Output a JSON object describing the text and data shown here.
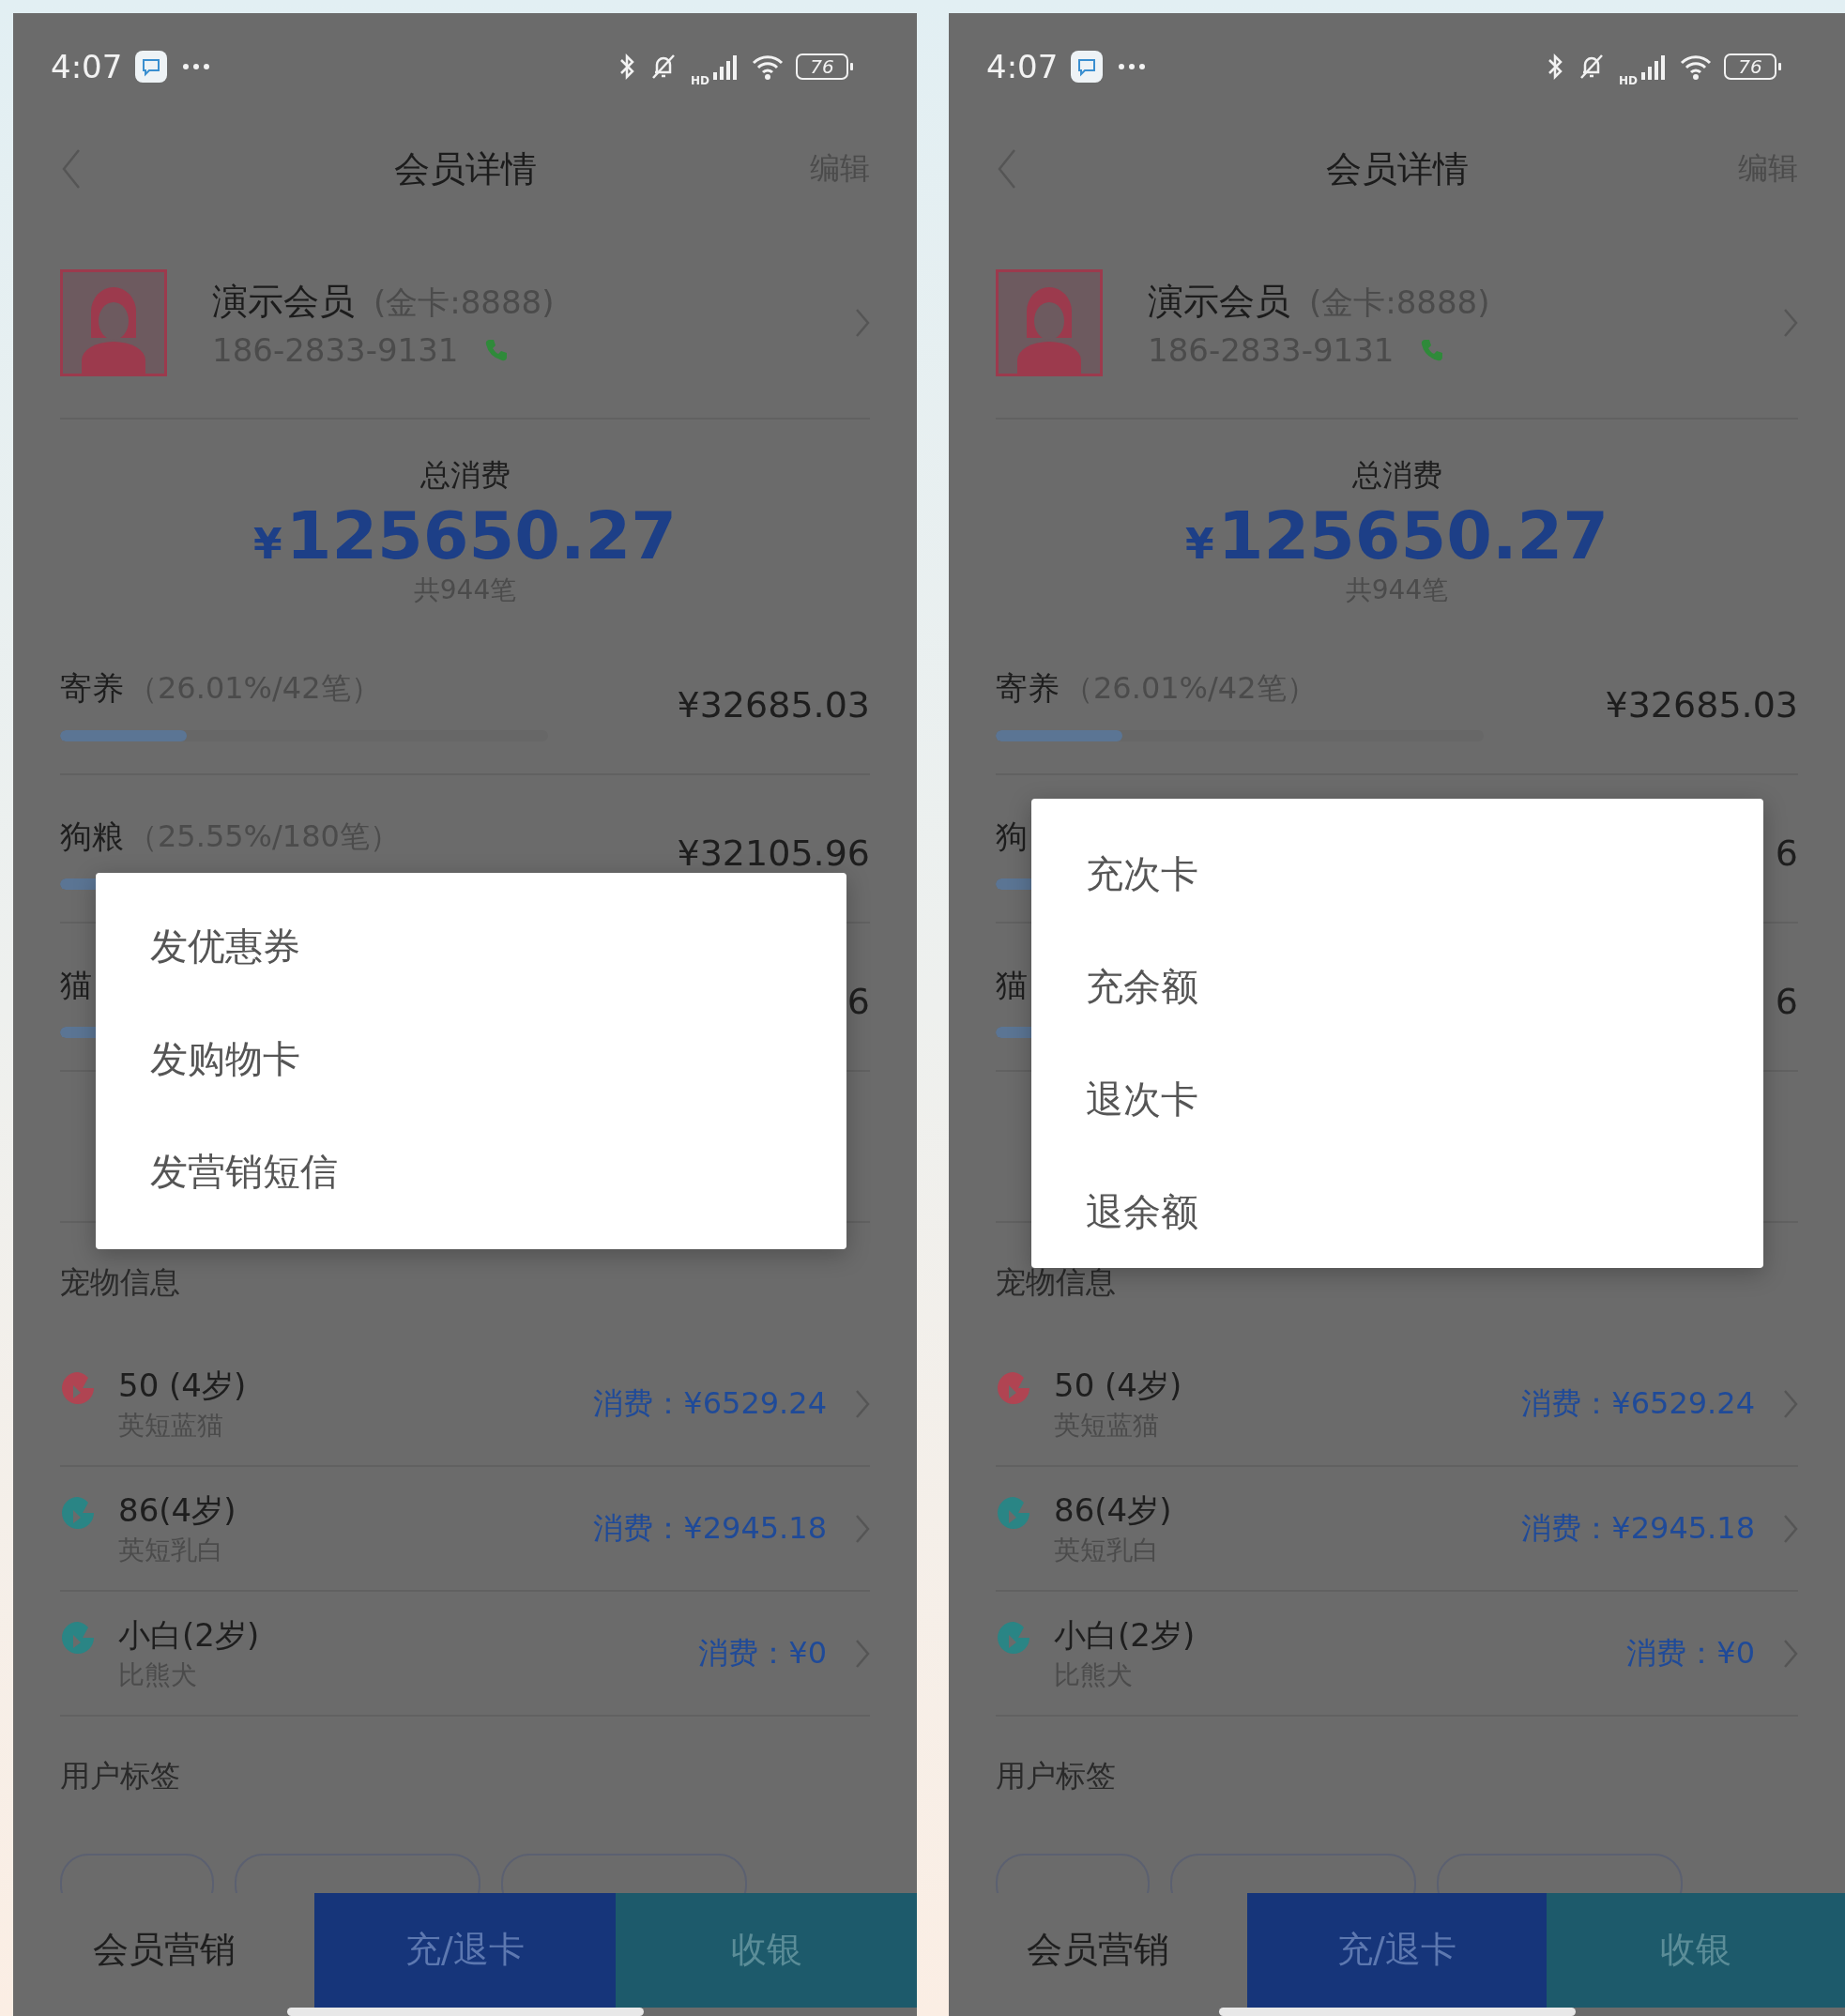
{
  "phones": [
    {
      "status_bar": {
        "time": "4:07",
        "signal_label": "HD",
        "battery": "76"
      },
      "header": {
        "title": "会员详情",
        "action": "编辑"
      },
      "member": {
        "name": "演示会员",
        "card": "(金卡:8888)",
        "phone": "186-2833-9131"
      },
      "total": {
        "label": "总消费",
        "currency": "¥",
        "amount": "125650.27",
        "count": "共944笔"
      },
      "categories": [
        {
          "name": "寄养",
          "detail": "（26.01%/42笔）",
          "amount": "¥32685.03",
          "level": 0.26
        },
        {
          "name": "狗粮",
          "detail": "（25.55%/180笔）",
          "amount": "¥32105.96",
          "level": 0.26
        },
        {
          "name": "猫",
          "amount": "6",
          "level": 0.26
        }
      ],
      "popup": {
        "items": [
          "发优惠券",
          "发购物卡",
          "发营销短信"
        ]
      },
      "pets_title": "宠物信息",
      "pets": [
        {
          "name": "50 (4岁)",
          "breed": "英短蓝猫",
          "spend": "消费：¥6529.24",
          "color": "#b04452"
        },
        {
          "name": "86(4岁)",
          "breed": "英短乳白",
          "spend": "消费：¥2945.18",
          "color": "#2a8585"
        },
        {
          "name": "小白(2岁)",
          "breed": "比熊犬",
          "spend": "消费：¥0",
          "color": "#2a8585"
        }
      ],
      "tags_title": "用户标签",
      "actions": [
        {
          "label": "会员营销",
          "kind": "plain"
        },
        {
          "label": "充/退卡",
          "kind": "primary"
        },
        {
          "label": "收银",
          "kind": "secondary"
        }
      ]
    },
    {
      "status_bar": {
        "time": "4:07",
        "signal_label": "HD",
        "battery": "76"
      },
      "header": {
        "title": "会员详情",
        "action": "编辑"
      },
      "member": {
        "name": "演示会员",
        "card": "(金卡:8888)",
        "phone": "186-2833-9131"
      },
      "total": {
        "label": "总消费",
        "currency": "¥",
        "amount": "125650.27",
        "count": "共944笔"
      },
      "categories": [
        {
          "name": "寄养",
          "detail": "（26.01%/42笔）",
          "amount": "¥32685.03",
          "level": 0.26
        },
        {
          "name": "狗",
          "amount": "6",
          "level": 0.26
        },
        {
          "name": "猫",
          "amount": "6",
          "level": 0.26
        }
      ],
      "popup": {
        "items": [
          "充次卡",
          "充余额",
          "退次卡",
          "退余额"
        ]
      },
      "pets_title": "宠物信息",
      "pets": [
        {
          "name": "50 (4岁)",
          "breed": "英短蓝猫",
          "spend": "消费：¥6529.24",
          "color": "#b04452"
        },
        {
          "name": "86(4岁)",
          "breed": "英短乳白",
          "spend": "消费：¥2945.18",
          "color": "#2a8585"
        },
        {
          "name": "小白(2岁)",
          "breed": "比熊犬",
          "spend": "消费：¥0",
          "color": "#2a8585"
        }
      ],
      "tags_title": "用户标签",
      "actions": [
        {
          "label": "会员营销",
          "kind": "plain"
        },
        {
          "label": "充/退卡",
          "kind": "primary"
        },
        {
          "label": "收银",
          "kind": "secondary"
        }
      ]
    }
  ]
}
